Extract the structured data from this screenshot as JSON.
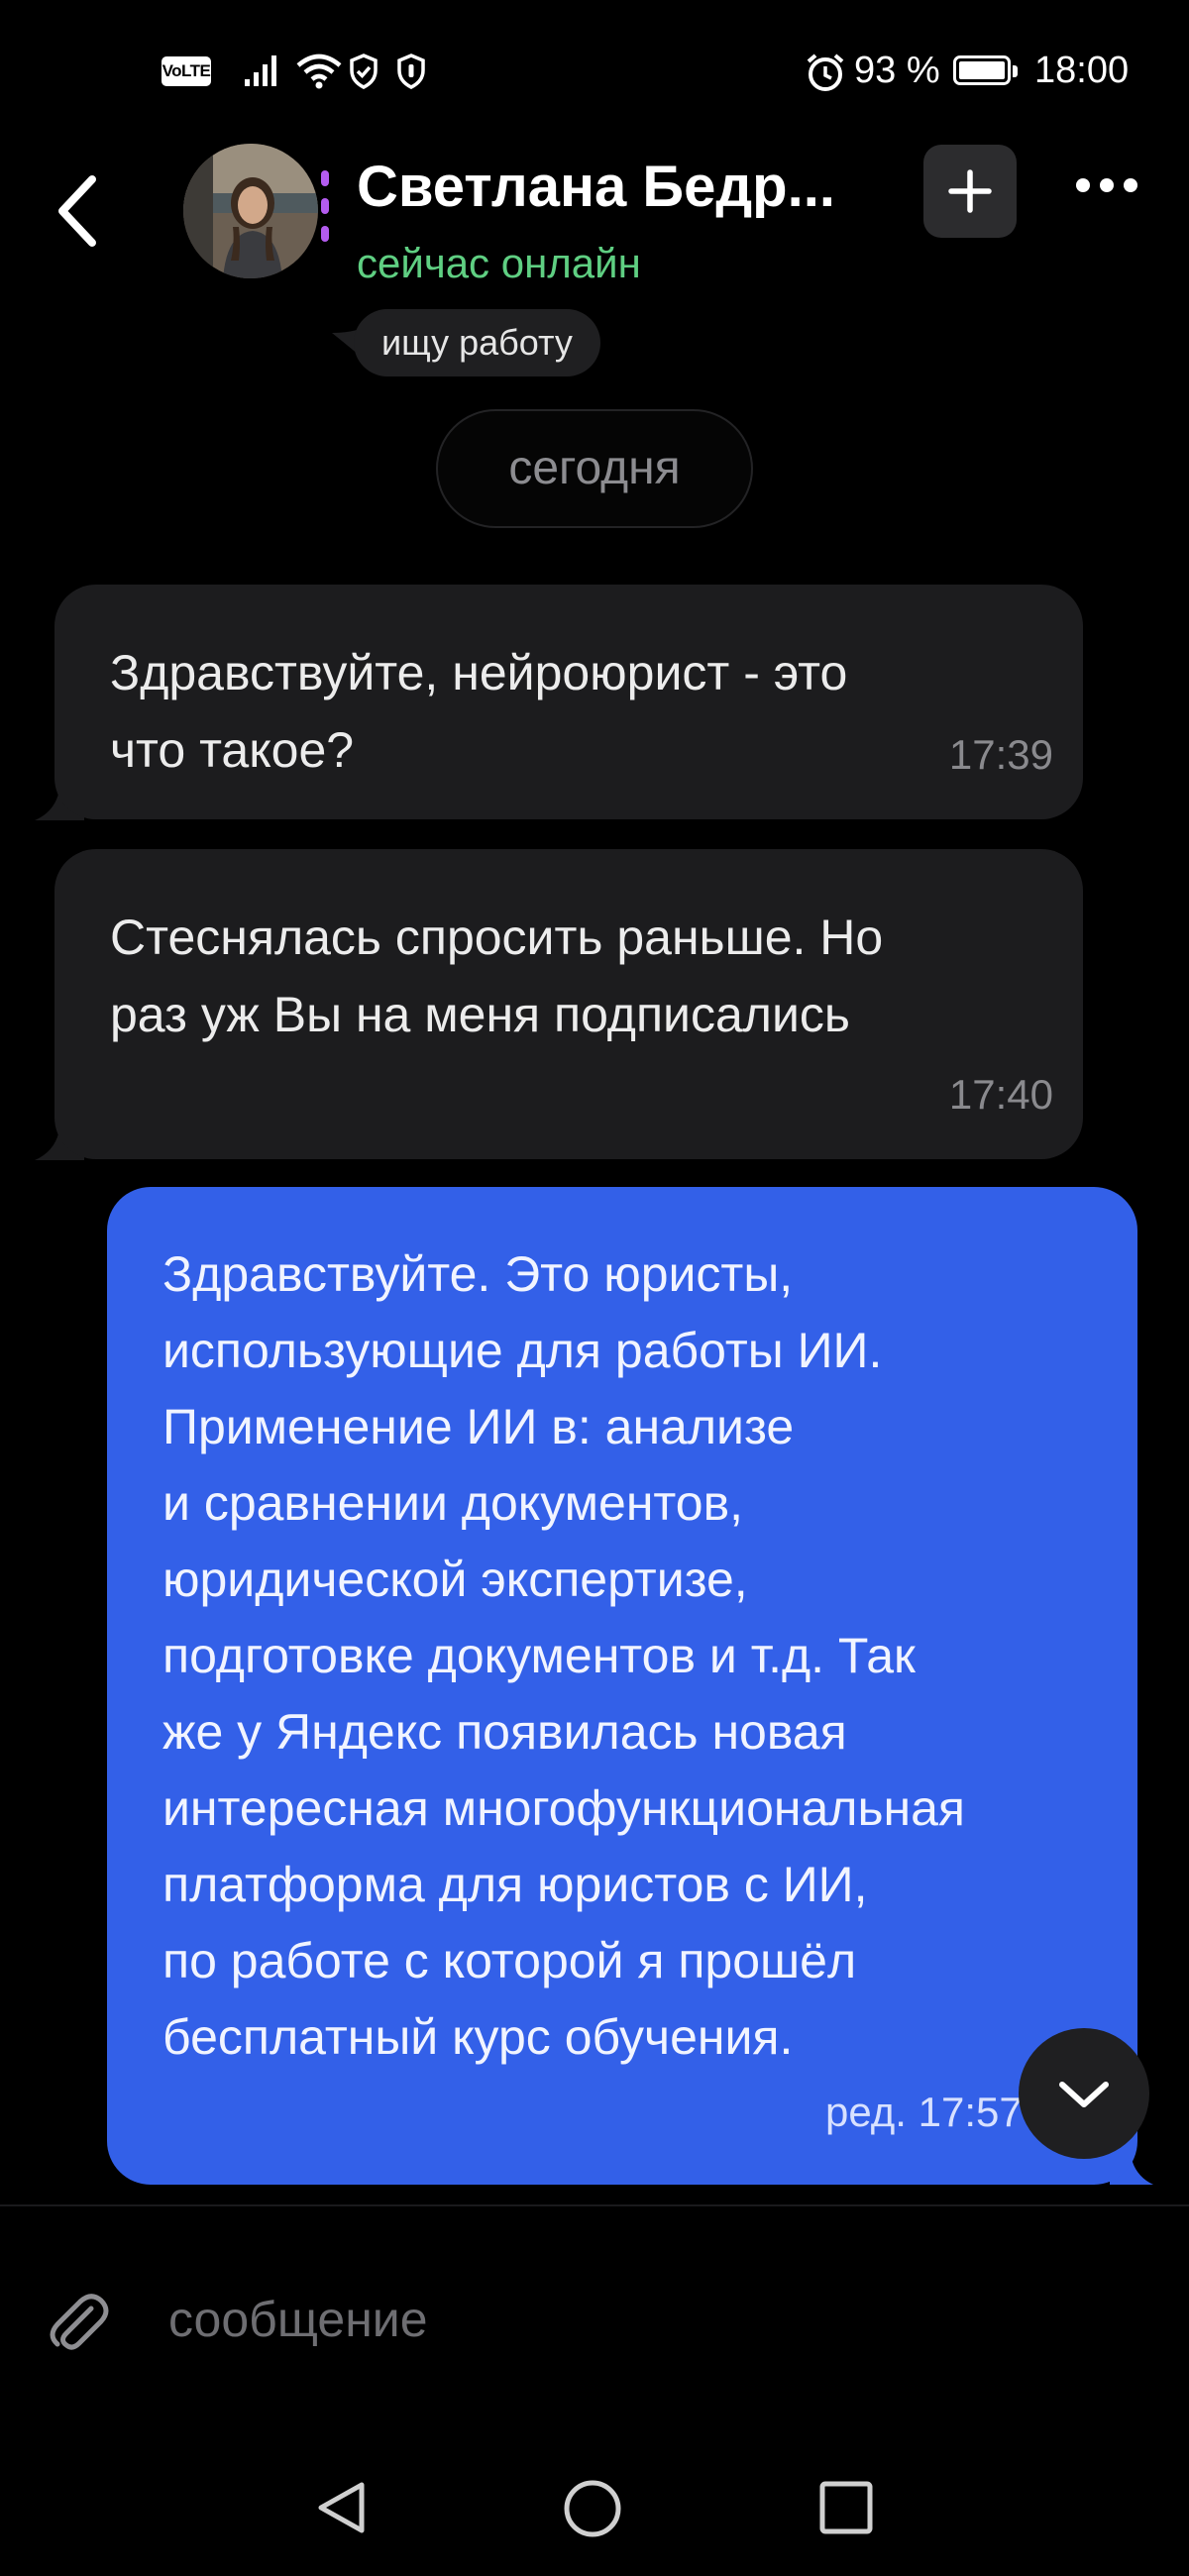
{
  "status_bar": {
    "volte": "VoLTE",
    "battery_pct": "93 %",
    "time": "18:00",
    "icons": [
      "signal-icon",
      "wifi-icon",
      "shield-icon",
      "shield-icon",
      "alarm-icon",
      "battery-icon"
    ]
  },
  "header": {
    "contact_name": "Светлана Бедр...",
    "presence": "сейчас онлайн",
    "status_note": "ищу работу",
    "icons": [
      "back-icon",
      "avatar",
      "plus-icon",
      "more-icon"
    ]
  },
  "date_separator": "сегодня",
  "messages": [
    {
      "direction": "in",
      "text": "Здравствуйте, нейроюрист - это\nчто такое?",
      "time": "17:39"
    },
    {
      "direction": "in",
      "text": "Стеснялась спросить раньше. Но\nраз уж Вы на меня подписались",
      "time": "17:40"
    },
    {
      "direction": "out",
      "text": "Здравствуйте. Это юристы,\nиспользующие для работы ИИ.\nПрименение ИИ в: анализе\nи сравнении документов,\nюридической экспертизе,\nподготовке документов и т.д. Так\nже у Яндекс появилась новая\nинтересная многофункциональная\nплатформа для юристов с ИИ,\nпо работе с которой я прошёл\nбесплатный курс обучения.",
      "time": "ред. 17:57"
    }
  ],
  "composer": {
    "placeholder": "сообщение"
  },
  "colors": {
    "outgoing_bubble": "#3360e8",
    "incoming_bubble": "#1c1c1e",
    "online": "#5fcf82",
    "background": "#000000"
  }
}
